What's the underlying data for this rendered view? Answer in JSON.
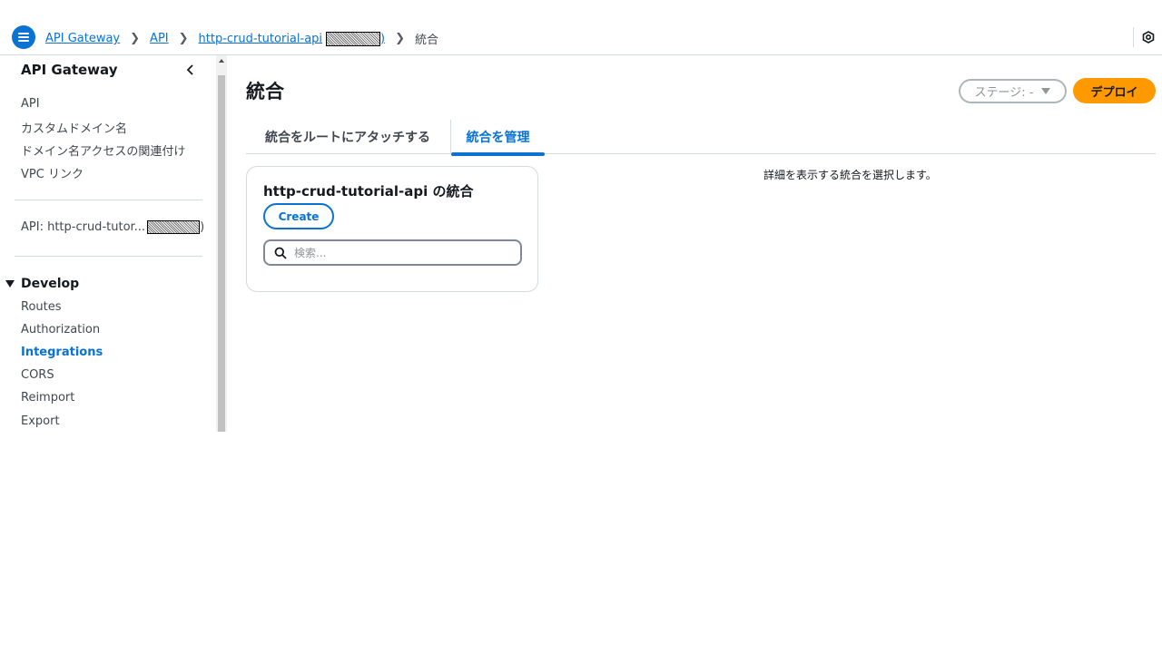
{
  "breadcrumb": {
    "items": [
      "API Gateway",
      "API",
      "http-crud-tutorial-api",
      "統合"
    ],
    "item_3_suffix": ")"
  },
  "sidebar": {
    "title": "API Gateway",
    "top_items": [
      "API",
      "カスタムドメイン名",
      "ドメイン名アクセスの関連付け",
      "VPC リンク"
    ],
    "api_label": "API: http-crud-tutor...",
    "api_label_suffix": ")",
    "section": "Develop",
    "develop_items": [
      "Routes",
      "Authorization",
      "Integrations",
      "CORS",
      "Reimport",
      "Export"
    ],
    "active_item": "Integrations"
  },
  "main": {
    "title": "統合",
    "stage_button": "ステージ: -",
    "deploy_button": "デプロイ",
    "tabs": [
      "統合をルートにアタッチする",
      "統合を管理"
    ],
    "active_tab": "統合を管理",
    "card": {
      "title": "http-crud-tutorial-api の統合",
      "create_button": "Create",
      "search_placeholder": "検索..."
    },
    "detail_hint": "詳細を表示する統合を選択します。"
  },
  "colors": {
    "accent": "#0972d3",
    "deploy": "#ff9900"
  },
  "icons": [
    "menu-icon",
    "chevron-right-icon",
    "chevron-left-icon",
    "search-icon",
    "caret-down-icon",
    "settings-hexagon-icon"
  ]
}
